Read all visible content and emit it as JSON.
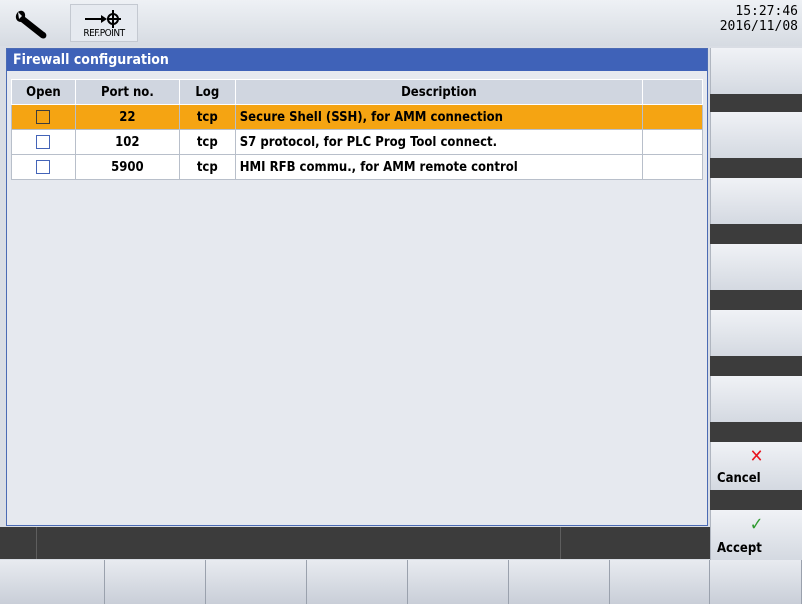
{
  "topbar": {
    "wrench_icon": "wrench-icon",
    "refpoint_label": "REF.POINT",
    "time": "15:27:46",
    "date": "2016/11/08"
  },
  "panel": {
    "title": "Firewall configuration",
    "columns": [
      "Open",
      "Port no.",
      "Log",
      "Description",
      ""
    ],
    "rows": [
      {
        "open": false,
        "port": "22",
        "log": "tcp",
        "description": "Secure Shell (SSH), for AMM connection",
        "selected": true
      },
      {
        "open": false,
        "port": "102",
        "log": "tcp",
        "description": "S7 protocol, for PLC Prog Tool connect.",
        "selected": false
      },
      {
        "open": false,
        "port": "5900",
        "log": "tcp",
        "description": "HMI RFB commu., for AMM remote control",
        "selected": false
      }
    ]
  },
  "softkeys": {
    "cancel": {
      "label": "Cancel",
      "icon": "close-icon",
      "color": "#e8141e"
    },
    "accept": {
      "label": "Accept",
      "icon": "checkmark-icon",
      "color": "#2e9a2e"
    }
  },
  "colors": {
    "title_bar": "#3f62b8",
    "selected_row": "#f5a412"
  }
}
